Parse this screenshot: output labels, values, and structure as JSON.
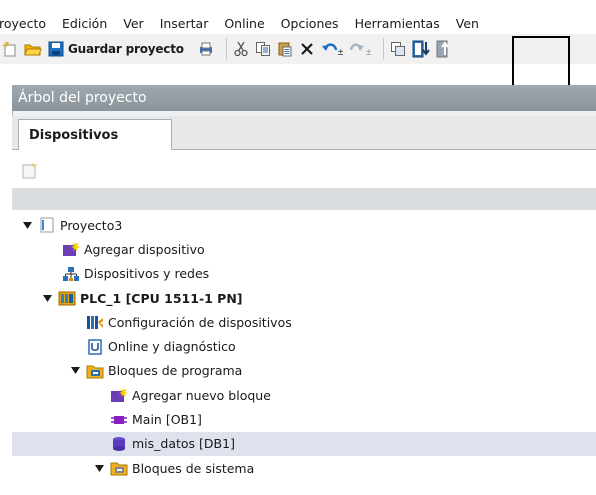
{
  "menubar": {
    "items": [
      "royecto",
      "Edición",
      "Ver",
      "Insertar",
      "Online",
      "Opciones",
      "Herramientas",
      "Ven"
    ]
  },
  "toolbar": {
    "save_label": "Guardar proyecto"
  },
  "panel": {
    "title": "Árbol del proyecto",
    "tab_label": "Dispositivos"
  },
  "tree": {
    "items": [
      {
        "label": "Proyecto3",
        "icon": "project-icon",
        "expanded": true
      },
      {
        "label": "Agregar dispositivo",
        "icon": "add-device-icon"
      },
      {
        "label": "Dispositivos y redes",
        "icon": "network-icon"
      },
      {
        "label": "PLC_1 [CPU 1511-1 PN]",
        "icon": "plc-icon",
        "expanded": true
      },
      {
        "label": "Configuración de dispositivos",
        "icon": "device-config-icon"
      },
      {
        "label": "Online y diagnóstico",
        "icon": "diagnostics-icon"
      },
      {
        "label": "Bloques de programa",
        "icon": "folder-icon",
        "expanded": true
      },
      {
        "label": "Agregar nuevo bloque",
        "icon": "add-block-icon"
      },
      {
        "label": "Main [OB1]",
        "icon": "ob-block-icon"
      },
      {
        "label": "mis_datos [DB1]",
        "icon": "db-block-icon",
        "selected": true
      },
      {
        "label": "Bloques de sistema",
        "icon": "folder-icon",
        "expanded": true
      }
    ]
  },
  "colors": {
    "panel_header": "#9aa3a9",
    "selected_row": "#dde2ec",
    "accent_blue": "#1f6fc5",
    "folder_orange": "#e8a400"
  }
}
